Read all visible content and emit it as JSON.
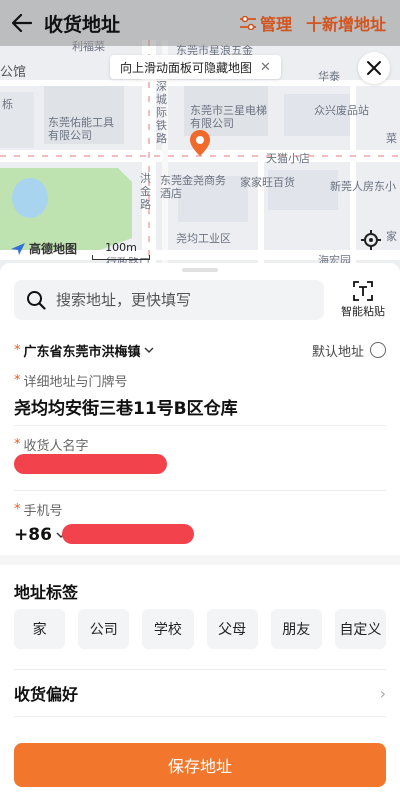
{
  "header": {
    "title": "收货地址",
    "manage_label": "管理",
    "add_label": "十新增地址",
    "accent": "#d2541f"
  },
  "map": {
    "tip_text": "向上滑动面板可隐藏地图",
    "labels": [
      "利福菜",
      "东莞市星浪五金",
      "公馆",
      "华泰",
      "栎",
      "深城际铁路",
      "东莞市三星电梯有限公司",
      "众兴废品站",
      "东莞佑能工具有限公司",
      "菜",
      "天猫小店",
      "洪金路",
      "东莞金尧商务酒店",
      "家家旺百货",
      "新莞人房东小",
      "尧均工业区",
      "家",
      "海宏园",
      "行政路口"
    ],
    "logo_text": "高德地图",
    "scale_text": "100m"
  },
  "search": {
    "placeholder": "搜索地址，更快填写",
    "smart_paste_label": "智能粘贴"
  },
  "region": {
    "value": "广东省东莞市洪梅镇",
    "default_label": "默认地址"
  },
  "fields": {
    "address_label": "详细地址与门牌号",
    "address_value": "尧均均安街三巷11号B区仓库",
    "name_label": "收货人名字",
    "phone_label": "手机号",
    "phone_prefix": "+86"
  },
  "tags": {
    "title": "地址标签",
    "items": [
      "家",
      "公司",
      "学校",
      "父母",
      "朋友",
      "自定义"
    ]
  },
  "preference": {
    "label": "收货偏好"
  },
  "save_label": "保存地址",
  "colors": {
    "required_star": "#e85a1c",
    "save_button": "#f2772d",
    "redaction": "#f2424b"
  }
}
